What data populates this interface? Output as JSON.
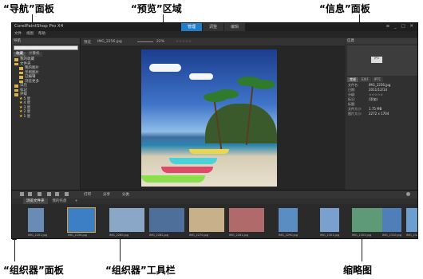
{
  "callouts": {
    "navigation": "“导航”面板",
    "preview": "“预览”区域",
    "info": "“信息”面板",
    "organizer": "“组织器”面板",
    "organizer_toolbar": "“组织器”工具栏",
    "thumbnails": "缩略图"
  },
  "app": {
    "title": "CorelPaintShop Pro X4",
    "mode_tabs": [
      "管理",
      "调整",
      "编辑"
    ],
    "window_controls": "≡ _ □ ✕",
    "menus": [
      "文件",
      "视图",
      "帮助"
    ]
  },
  "navigation": {
    "header": "导航",
    "tabs": [
      "收藏",
      "计算机"
    ],
    "tree": [
      {
        "label": "我的收藏",
        "type": "folder"
      },
      {
        "label": "文件夹",
        "type": "folder"
      },
      {
        "label": "我的图片",
        "type": "folder"
      },
      {
        "label": "示例图片",
        "type": "folder"
      },
      {
        "label": "已编辑",
        "type": "folder"
      },
      {
        "label": "浏览更多",
        "type": "folder"
      },
      {
        "label": "日历",
        "type": "folder"
      },
      {
        "label": "标记",
        "type": "folder"
      },
      {
        "label": "评级",
        "type": "folder"
      },
      {
        "label": "5 星",
        "type": "star"
      },
      {
        "label": "4 星",
        "type": "star"
      },
      {
        "label": "3 星",
        "type": "star"
      },
      {
        "label": "2 星",
        "type": "star"
      },
      {
        "label": "1 星",
        "type": "star"
      }
    ]
  },
  "preview": {
    "label": "预览",
    "filename": "IMG_2256.jpg",
    "zoom": "22%",
    "rating": "☆☆☆☆☆"
  },
  "info": {
    "header": "信息",
    "thumb_label": "JPG",
    "tabs": [
      "常规",
      "EXIF",
      "IPTC"
    ],
    "rows": [
      {
        "k": "文件名:",
        "v": "IMG_2256.jpg"
      },
      {
        "k": "日期:",
        "v": "2011/12/14"
      },
      {
        "k": "分级:",
        "v": "☆☆☆☆☆"
      },
      {
        "k": "标记:",
        "v": "(添加)"
      },
      {
        "k": "标题:",
        "v": ""
      },
      {
        "k": "文件大小:",
        "v": "1.75 MB"
      },
      {
        "k": "图片大小:",
        "v": "2272 x 1704"
      }
    ]
  },
  "organizer": {
    "toolbar_labels": [
      "打印",
      "分享",
      "分类"
    ],
    "tabs": [
      "浏览文件夹",
      "我的托盘"
    ],
    "add_tab": "+",
    "thumbnails": [
      {
        "caption": "IMG_2201.jpg",
        "bg": "#6a8bb5"
      },
      {
        "caption": "IMG_2256.jpg",
        "bg": "#3c7fc4"
      },
      {
        "caption": "IMG_2260.jpg",
        "bg": "#8aa7c8"
      },
      {
        "caption": "IMG_2262.jpg",
        "bg": "#4d6f99"
      },
      {
        "caption": "IMG_2270.jpg",
        "bg": "#c7b08a"
      },
      {
        "caption": "IMG_2281.jpg",
        "bg": "#b06a6a"
      },
      {
        "caption": "IMG_2290.jpg",
        "bg": "#5a8ec2"
      },
      {
        "caption": "IMG_2301.jpg",
        "bg": "#7aa0d0"
      },
      {
        "caption": "IMG_2305.jpg",
        "bg": "#5f9a78"
      },
      {
        "caption": "IMG_2310.jpg",
        "bg": "#4f7fb8"
      },
      {
        "caption": "IMG_2320.jpg",
        "bg": "#6c9fcf"
      }
    ]
  }
}
